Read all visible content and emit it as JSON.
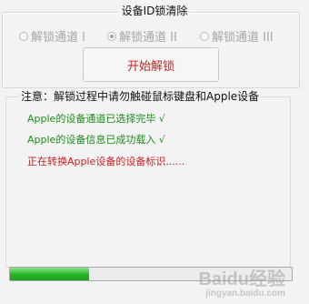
{
  "title": "设备ID锁清除",
  "radios": [
    {
      "label": "解锁通道 I",
      "checked": false
    },
    {
      "label": "解锁通道 II",
      "checked": true
    },
    {
      "label": "解锁通道 III",
      "checked": false
    }
  ],
  "start_button": "开始解锁",
  "notice": "注意：解锁过程中请勿触碰鼠标键盘和Apple设备",
  "log": [
    "Apple的设备通道已选择完毕 √",
    "Apple的设备信息已成功载入 √",
    "正在转换Apple设备的设备标识......"
  ],
  "progress": 0.28,
  "watermark": "Baidu经验",
  "watermark_sub": "jingyan.baidu.com",
  "colors": {
    "log_ok": "#1e8c1e",
    "log_pending": "#cc1f1f",
    "button_text": "#cc2222",
    "progress": "#23b523"
  }
}
